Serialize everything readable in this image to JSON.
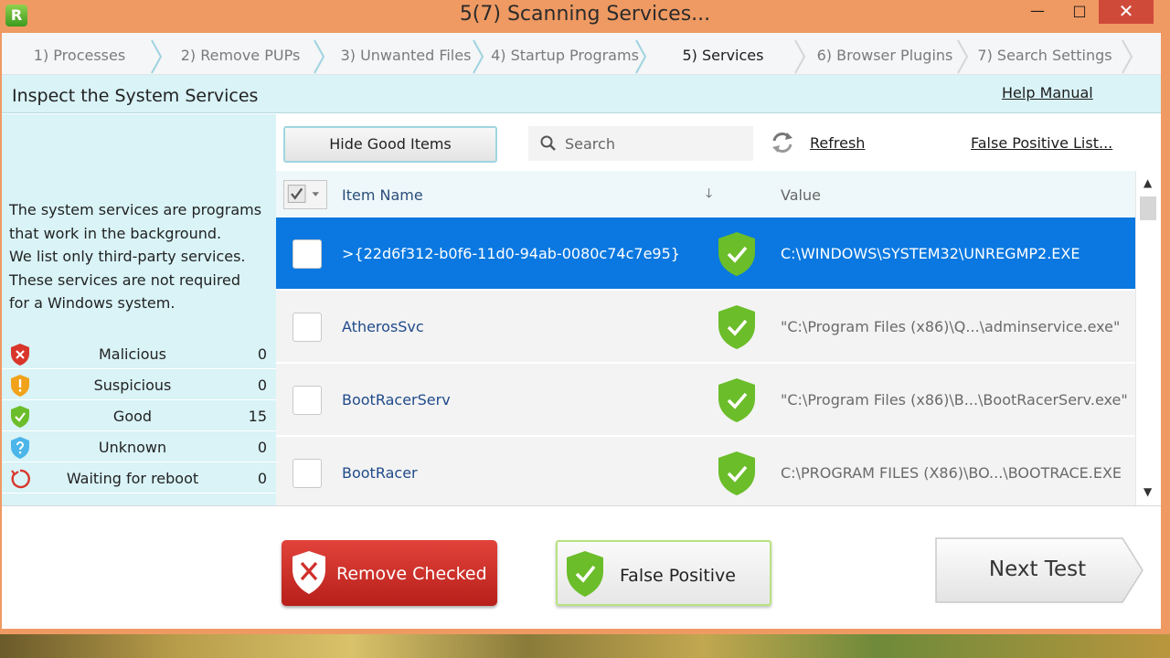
{
  "window": {
    "title": "5(7) Scanning Services...",
    "app_icon_letter": "R",
    "minimize_glyph": "—",
    "maximize_glyph": "□",
    "close_glyph": "✕"
  },
  "steps": [
    {
      "label": "1) Processes",
      "active": false
    },
    {
      "label": "2) Remove PUPs",
      "active": false
    },
    {
      "label": "3) Unwanted Files",
      "active": false
    },
    {
      "label": "4) Startup Programs",
      "active": false
    },
    {
      "label": "5) Services",
      "active": true
    },
    {
      "label": "6) Browser Plugins",
      "active": false
    },
    {
      "label": "7) Search Settings",
      "active": false
    }
  ],
  "section": {
    "title": "Inspect the System Services",
    "help_link": "Help Manual"
  },
  "left_pane": {
    "description": [
      "The system services are programs",
      "that work in the background.",
      "We list only third-party services.",
      "These services are not required",
      "for a Windows system."
    ],
    "stats": [
      {
        "label": "Malicious",
        "count": "0",
        "icon": "malicious-shield-icon",
        "color": "#d9362b"
      },
      {
        "label": "Suspicious",
        "count": "0",
        "icon": "suspicious-shield-icon",
        "color": "#f0a21a"
      },
      {
        "label": "Good",
        "count": "15",
        "icon": "good-shield-icon",
        "color": "#6bbd2a"
      },
      {
        "label": "Unknown",
        "count": "0",
        "icon": "unknown-shield-icon",
        "color": "#4cb6ea"
      },
      {
        "label": "Waiting for reboot",
        "count": "0",
        "icon": "reboot-icon",
        "color": "#d9362b"
      }
    ]
  },
  "toolbar": {
    "hide_button": "Hide Good Items",
    "search_placeholder": "Search",
    "refresh": "Refresh",
    "false_positive_list": "False Positive List..."
  },
  "table": {
    "headers": {
      "item_name": "Item Name",
      "sort_glyph": "🡓",
      "value": "Value"
    },
    "rows": [
      {
        "name": ">{22d6f312-b0f6-11d0-94ab-0080c74c7e95}",
        "value": "C:\\WINDOWS\\SYSTEM32\\UNREGMP2.EXE",
        "status": "good",
        "selected": true
      },
      {
        "name": "AtherosSvc",
        "value": "\"C:\\Program Files (x86)\\Q...\\adminservice.exe\"",
        "status": "good",
        "selected": false
      },
      {
        "name": "BootRacerServ",
        "value": "\"C:\\Program Files (x86)\\B...\\BootRacerServ.exe\"",
        "status": "good",
        "selected": false
      },
      {
        "name": "BootRacer",
        "value": "C:\\PROGRAM FILES (X86)\\BO...\\BOOTRACE.EXE",
        "status": "good",
        "selected": false
      }
    ]
  },
  "buttons": {
    "remove_checked": "Remove Checked",
    "false_positive": "False Positive",
    "next_test": "Next Test"
  },
  "colors": {
    "window_frame": "#ef9a63",
    "accent_panel": "#d9f3f7",
    "selection": "#0a78e0",
    "good_green": "#6bbd2a",
    "remove_red": "#d0302a"
  }
}
